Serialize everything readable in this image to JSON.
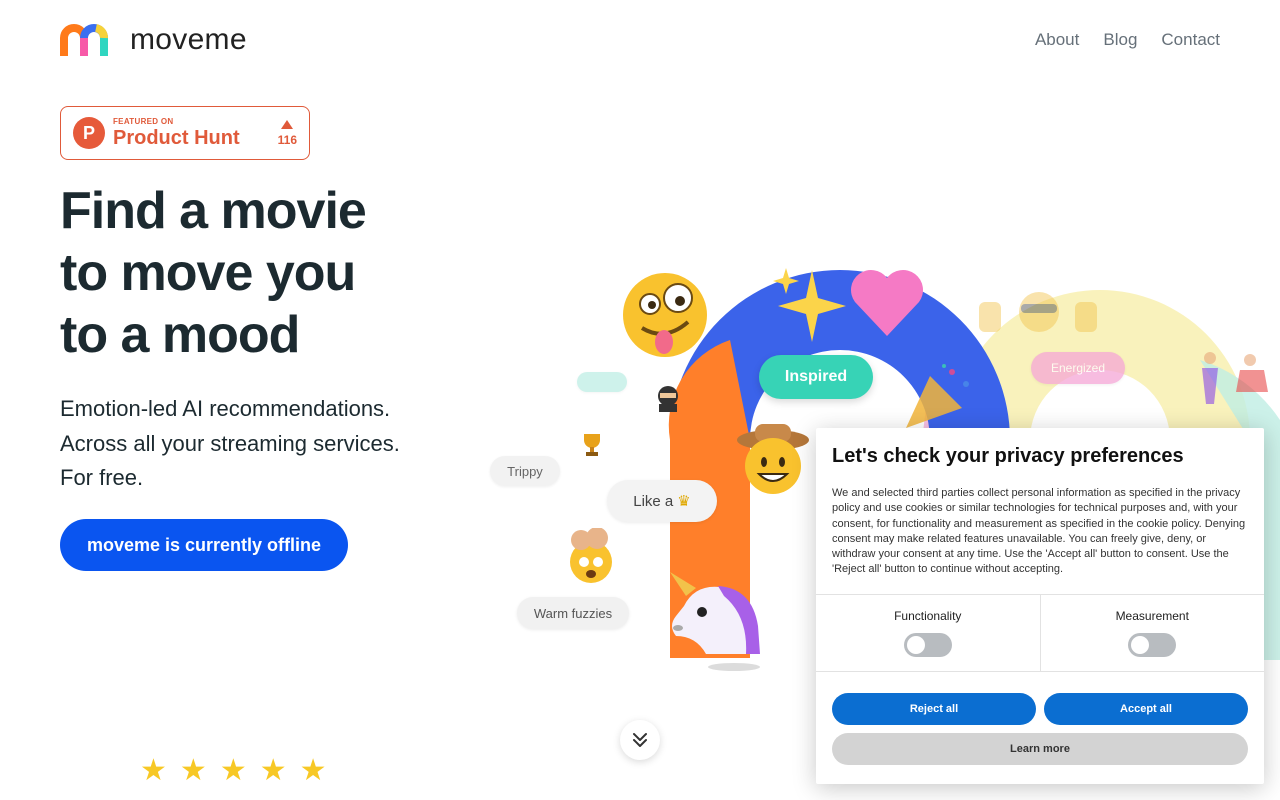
{
  "header": {
    "brand": "moveme",
    "nav": [
      "About",
      "Blog",
      "Contact"
    ]
  },
  "badge": {
    "featured": "FEATURED ON",
    "name": "Product Hunt",
    "votes": "116",
    "logo_letter": "P"
  },
  "hero": {
    "title": [
      "Find a movie",
      "to move you",
      "to a mood"
    ],
    "subtitle": [
      "Emotion-led AI recommendations.",
      "Across all your streaming services.",
      "For free."
    ],
    "cta": "moveme is currently offline"
  },
  "moods": {
    "inspired": "Inspired",
    "energized": "Energized",
    "trippy": "Trippy",
    "like_a": "Like a",
    "warm_fuzzies": "Warm fuzzies"
  },
  "rating": {
    "stars": 5
  },
  "privacy": {
    "title": "Let's check your privacy preferences",
    "body": "We and selected third parties collect personal information as specified in the privacy policy and use cookies or similar technologies for technical purposes and, with your consent, for functionality and measurement as specified in the cookie policy. Denying consent may make related features unavailable. You can freely give, deny, or withdraw your consent at any time. Use the 'Accept all' button to consent. Use the 'Reject all' button to continue without accepting.",
    "functionality": "Functionality",
    "measurement": "Measurement",
    "reject": "Reject all",
    "accept": "Accept all",
    "learn": "Learn more"
  },
  "colors": {
    "cta": "#0a55f0",
    "product_hunt": "#e05a3a",
    "dialog_button": "#0b6ed1"
  }
}
